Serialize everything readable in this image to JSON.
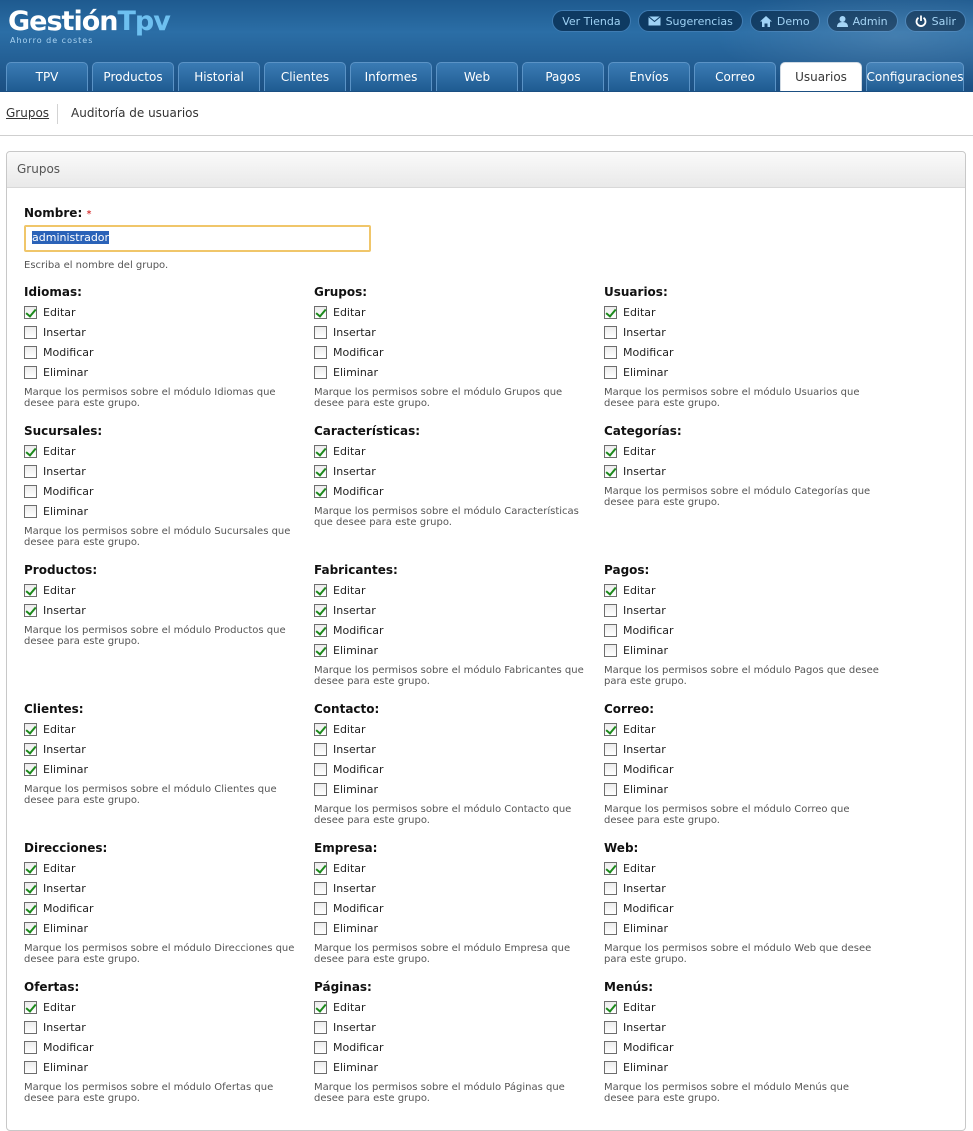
{
  "header": {
    "logo_main": "Gestión",
    "logo_accent": "Tpv",
    "logo_subtitle": "Ahorro de costes",
    "top_links": [
      {
        "label": "Ver Tienda",
        "icon": ""
      },
      {
        "label": "Sugerencias",
        "icon": "mail-icon"
      },
      {
        "label": "Demo",
        "icon": "home-icon"
      },
      {
        "label": "Admin",
        "icon": "user-icon"
      },
      {
        "label": "Salir",
        "icon": "power-icon"
      }
    ],
    "tabs": [
      "TPV",
      "Productos",
      "Historial",
      "Clientes",
      "Informes",
      "Web",
      "Pagos",
      "Envíos",
      "Correo",
      "Usuarios",
      "Configuraciones"
    ],
    "active_tab": "Usuarios"
  },
  "subnav": {
    "link": "Grupos",
    "current": "Auditoría de usuarios"
  },
  "panel": {
    "title": "Grupos",
    "name_label": "Nombre:",
    "required_mark": "*",
    "name_value": "administrador",
    "name_help": "Escriba el nombre del grupo."
  },
  "modules": [
    {
      "title": "Idiomas:",
      "perms": [
        {
          "label": "Editar",
          "checked": true
        },
        {
          "label": "Insertar",
          "checked": false
        },
        {
          "label": "Modificar",
          "checked": false
        },
        {
          "label": "Eliminar",
          "checked": false
        }
      ],
      "help": "Marque los permisos sobre el módulo Idiomas que desee para este grupo."
    },
    {
      "title": "Grupos:",
      "perms": [
        {
          "label": "Editar",
          "checked": true
        },
        {
          "label": "Insertar",
          "checked": false
        },
        {
          "label": "Modificar",
          "checked": false
        },
        {
          "label": "Eliminar",
          "checked": false
        }
      ],
      "help": "Marque los permisos sobre el módulo Grupos que desee para este grupo."
    },
    {
      "title": "Usuarios:",
      "perms": [
        {
          "label": "Editar",
          "checked": true
        },
        {
          "label": "Insertar",
          "checked": false
        },
        {
          "label": "Modificar",
          "checked": false
        },
        {
          "label": "Eliminar",
          "checked": false
        }
      ],
      "help": "Marque los permisos sobre el módulo Usuarios que desee para este grupo."
    },
    {
      "title": "Sucursales:",
      "perms": [
        {
          "label": "Editar",
          "checked": true
        },
        {
          "label": "Insertar",
          "checked": false
        },
        {
          "label": "Modificar",
          "checked": false
        },
        {
          "label": "Eliminar",
          "checked": false
        }
      ],
      "help": "Marque los permisos sobre el módulo Sucursales que desee para este grupo."
    },
    {
      "title": "Características:",
      "perms": [
        {
          "label": "Editar",
          "checked": true
        },
        {
          "label": "Insertar",
          "checked": true
        },
        {
          "label": "Modificar",
          "checked": true
        }
      ],
      "help": "Marque los permisos sobre el módulo Características que desee para este grupo."
    },
    {
      "title": "Categorías:",
      "perms": [
        {
          "label": "Editar",
          "checked": true
        },
        {
          "label": "Insertar",
          "checked": true
        }
      ],
      "help": "Marque los permisos sobre el módulo Categorías que desee para este grupo."
    },
    {
      "title": "Productos:",
      "perms": [
        {
          "label": "Editar",
          "checked": true
        },
        {
          "label": "Insertar",
          "checked": true
        }
      ],
      "help": "Marque los permisos sobre el módulo Productos que desee para este grupo."
    },
    {
      "title": "Fabricantes:",
      "perms": [
        {
          "label": "Editar",
          "checked": true
        },
        {
          "label": "Insertar",
          "checked": true
        },
        {
          "label": "Modificar",
          "checked": true
        },
        {
          "label": "Eliminar",
          "checked": true
        }
      ],
      "help": "Marque los permisos sobre el módulo Fabricantes que desee para este grupo."
    },
    {
      "title": "Pagos:",
      "perms": [
        {
          "label": "Editar",
          "checked": true
        },
        {
          "label": "Insertar",
          "checked": false
        },
        {
          "label": "Modificar",
          "checked": false
        },
        {
          "label": "Eliminar",
          "checked": false
        }
      ],
      "help": "Marque los permisos sobre el módulo Pagos que desee para este grupo."
    },
    {
      "title": "Clientes:",
      "perms": [
        {
          "label": "Editar",
          "checked": true
        },
        {
          "label": "Insertar",
          "checked": true
        },
        {
          "label": "Eliminar",
          "checked": true
        }
      ],
      "help": "Marque los permisos sobre el módulo Clientes que desee para este grupo."
    },
    {
      "title": "Contacto:",
      "perms": [
        {
          "label": "Editar",
          "checked": true
        },
        {
          "label": "Insertar",
          "checked": false
        },
        {
          "label": "Modificar",
          "checked": false
        },
        {
          "label": "Eliminar",
          "checked": false
        }
      ],
      "help": "Marque los permisos sobre el módulo Contacto que desee para este grupo."
    },
    {
      "title": "Correo:",
      "perms": [
        {
          "label": "Editar",
          "checked": true
        },
        {
          "label": "Insertar",
          "checked": false
        },
        {
          "label": "Modificar",
          "checked": false
        },
        {
          "label": "Eliminar",
          "checked": false
        }
      ],
      "help": "Marque los permisos sobre el módulo Correo que desee para este grupo."
    },
    {
      "title": "Direcciones:",
      "perms": [
        {
          "label": "Editar",
          "checked": true
        },
        {
          "label": "Insertar",
          "checked": true
        },
        {
          "label": "Modificar",
          "checked": true
        },
        {
          "label": "Eliminar",
          "checked": true
        }
      ],
      "help": "Marque los permisos sobre el módulo Direcciones que desee para este grupo."
    },
    {
      "title": "Empresa:",
      "perms": [
        {
          "label": "Editar",
          "checked": true
        },
        {
          "label": "Insertar",
          "checked": false
        },
        {
          "label": "Modificar",
          "checked": false
        },
        {
          "label": "Eliminar",
          "checked": false
        }
      ],
      "help": "Marque los permisos sobre el módulo Empresa que desee para este grupo."
    },
    {
      "title": "Web:",
      "perms": [
        {
          "label": "Editar",
          "checked": true
        },
        {
          "label": "Insertar",
          "checked": false
        },
        {
          "label": "Modificar",
          "checked": false
        },
        {
          "label": "Eliminar",
          "checked": false
        }
      ],
      "help": "Marque los permisos sobre el módulo Web que desee para este grupo."
    },
    {
      "title": "Ofertas:",
      "perms": [
        {
          "label": "Editar",
          "checked": true
        },
        {
          "label": "Insertar",
          "checked": false
        },
        {
          "label": "Modificar",
          "checked": false
        },
        {
          "label": "Eliminar",
          "checked": false
        }
      ],
      "help": "Marque los permisos sobre el módulo Ofertas que desee para este grupo."
    },
    {
      "title": "Páginas:",
      "perms": [
        {
          "label": "Editar",
          "checked": true
        },
        {
          "label": "Insertar",
          "checked": false
        },
        {
          "label": "Modificar",
          "checked": false
        },
        {
          "label": "Eliminar",
          "checked": false
        }
      ],
      "help": "Marque los permisos sobre el módulo Páginas que desee para este grupo."
    },
    {
      "title": "Menús:",
      "perms": [
        {
          "label": "Editar",
          "checked": true
        },
        {
          "label": "Insertar",
          "checked": false
        },
        {
          "label": "Modificar",
          "checked": false
        },
        {
          "label": "Eliminar",
          "checked": false
        }
      ],
      "help": "Marque los permisos sobre el módulo Menús que desee para este grupo."
    }
  ]
}
